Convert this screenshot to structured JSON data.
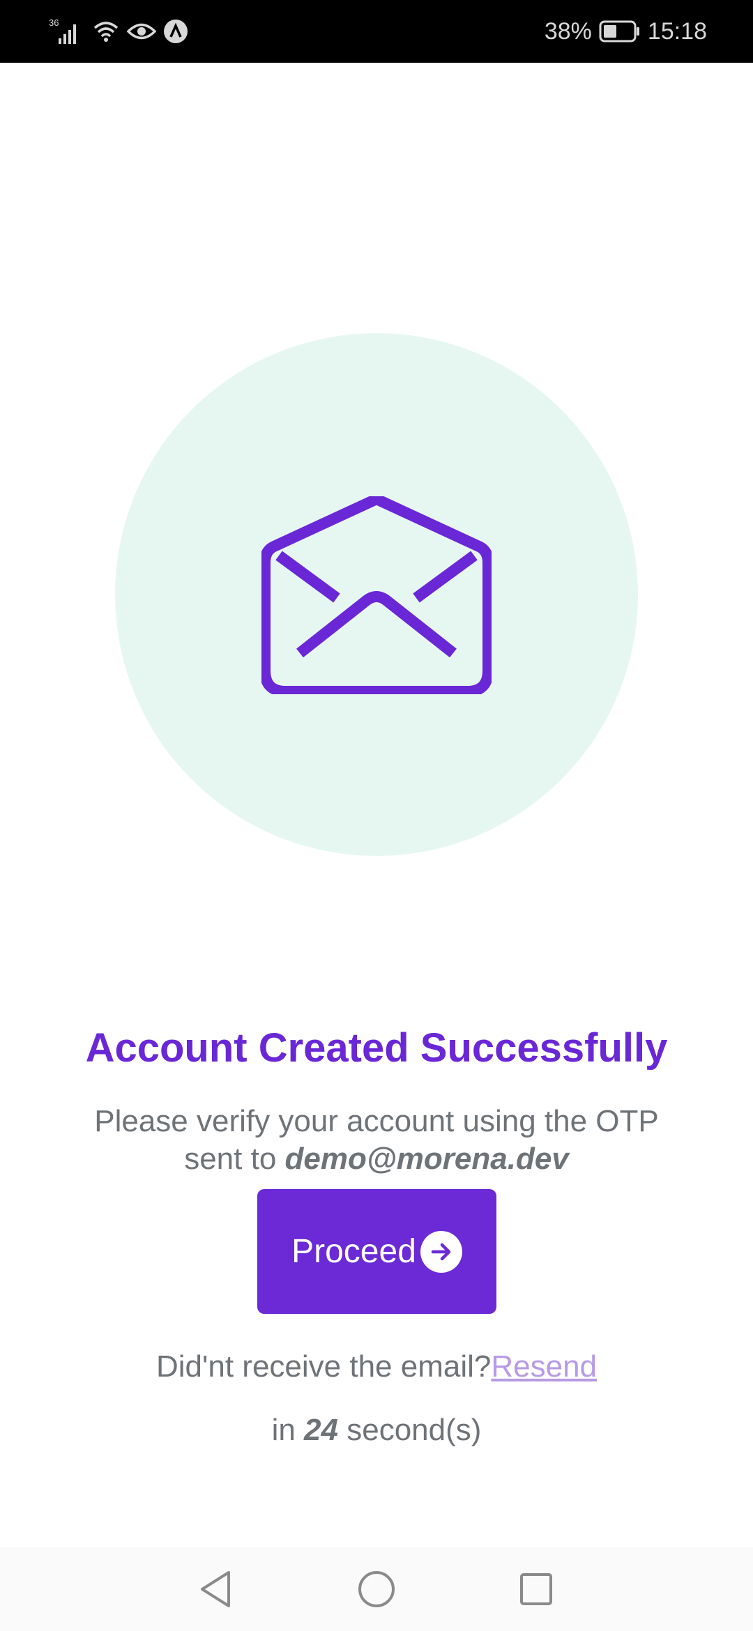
{
  "status_bar": {
    "network": "36",
    "battery": "38%",
    "time": "15:18",
    "icons": [
      "signal-icon",
      "wifi-icon",
      "eye-icon",
      "app-notification-icon",
      "battery-icon"
    ]
  },
  "hero": {
    "icon": "open-envelope-icon",
    "circle_color": "#e6f7f2",
    "icon_color": "#6a27d6"
  },
  "main": {
    "title": "Account Created Successfully",
    "subtitle_line1": "Please verify your account using the OTP",
    "subtitle_prefix": "sent to",
    "email": "demo@morena.dev",
    "proceed_label": "Proceed",
    "proceed_icon": "arrow-right-circle-icon",
    "resend_prompt": "Did'nt receive the email?",
    "resend_link": "Resend",
    "countdown_prefix": "in",
    "countdown_value": "24",
    "countdown_suffix": "second(s)"
  },
  "nav_bar": {
    "icons": [
      "back-triangle-icon",
      "home-circle-icon",
      "recents-square-icon"
    ]
  },
  "colors": {
    "accent": "#6b2ad6",
    "text_gray": "#6e7378",
    "link": "#b79ae6"
  }
}
